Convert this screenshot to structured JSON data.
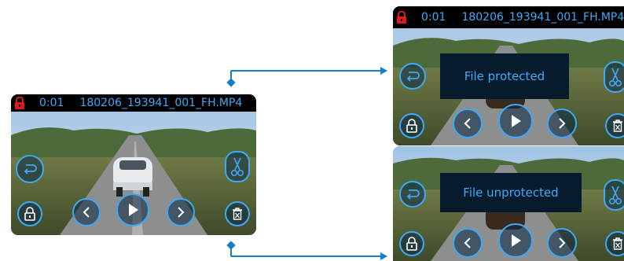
{
  "colors": {
    "accent": "#3fa9f5",
    "lock_red": "#e0191f",
    "bar": "#000000",
    "message_bg": "#071b2e",
    "connector": "#1a7dc3"
  },
  "main_screen": {
    "timecode": "0:01",
    "filename": "180206_193941_001_FH.MP4",
    "lock_icon": "padlock-red-icon"
  },
  "protected_screen": {
    "timecode": "0:01",
    "filename": "180206_193941_001_FH.MP4",
    "message": "File protected"
  },
  "unprotected_screen": {
    "message": "File unprotected"
  },
  "controls": {
    "back": "back-arrow-icon",
    "cut": "scissors-icon",
    "lock": "lock-icon",
    "prev": "chevron-left-icon",
    "play": "play-icon",
    "next": "chevron-right-icon",
    "delete": "trash-icon"
  }
}
